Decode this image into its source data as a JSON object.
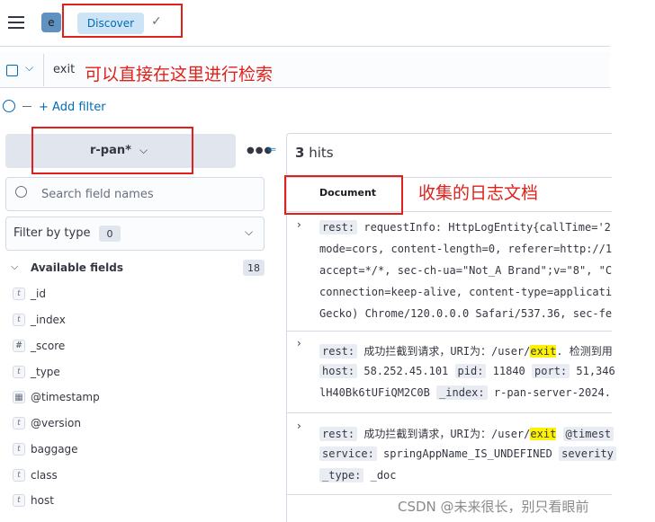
{
  "header": {
    "app_badge": "e",
    "tab_label": "Discover"
  },
  "query": {
    "value": "exit"
  },
  "filter": {
    "add_label": "+ Add filter"
  },
  "sidebar": {
    "index_pattern": "r-pan*",
    "search_placeholder": "Search field names",
    "filter_by_type": "Filter by type",
    "filter_count": "0",
    "available_label": "Available fields",
    "available_count": "18",
    "fields": [
      {
        "type": "t",
        "name": "_id"
      },
      {
        "type": "t",
        "name": "_index"
      },
      {
        "type": "#",
        "name": "_score"
      },
      {
        "type": "t",
        "name": "_type"
      },
      {
        "type": "cal",
        "name": "@timestamp"
      },
      {
        "type": "t",
        "name": "@version"
      },
      {
        "type": "t",
        "name": "baggage"
      },
      {
        "type": "t",
        "name": "class"
      },
      {
        "type": "t",
        "name": "host"
      }
    ]
  },
  "results": {
    "hits_count": "3",
    "hits_label": "hits",
    "column_header": "Document",
    "doc1": {
      "l1_key": "rest:",
      "l1_val": "requestInfo: HttpLogEntity{callTime='2",
      "l2": "mode=cors, content-length=0, referer=http://1",
      "l3": "accept=*/*, sec-ch-ua=\"Not_A Brand\";v=\"8\", \"C",
      "l4": "connection=keep-alive, content-type=applicati",
      "l5": "Gecko) Chrome/120.0.0.0 Safari/537.36, sec-fe"
    },
    "doc2": {
      "k_rest": "rest:",
      "v_rest_pre": "成功拦截到请求，URI为：/user/",
      "v_rest_hl": "exit",
      "v_rest_post": ". 检测到用",
      "k_host": "host:",
      "v_host": "58.252.45.101",
      "k_pid": "pid:",
      "v_pid": "11840",
      "k_port": "port:",
      "v_port": "51,346",
      "l3_val": "lH40Bk6tUFiQM2C0B",
      "k_index": "_index:",
      "v_index": "r-pan-server-2024."
    },
    "doc3": {
      "k_rest": "rest:",
      "v_rest_pre": "成功拦截到请求，URI为：/user/",
      "v_rest_hl": "exit",
      "k_ts": "@timest",
      "k_service": "service:",
      "v_service": "springAppName_IS_UNDEFINED",
      "k_sev": "severity",
      "k_type": "_type:",
      "v_type": "_doc"
    }
  },
  "annotations": {
    "query_note": "可以直接在这里进行检索",
    "doc_note": "收集的日志文档"
  },
  "watermark": "CSDN @未来很长，别只看眼前"
}
